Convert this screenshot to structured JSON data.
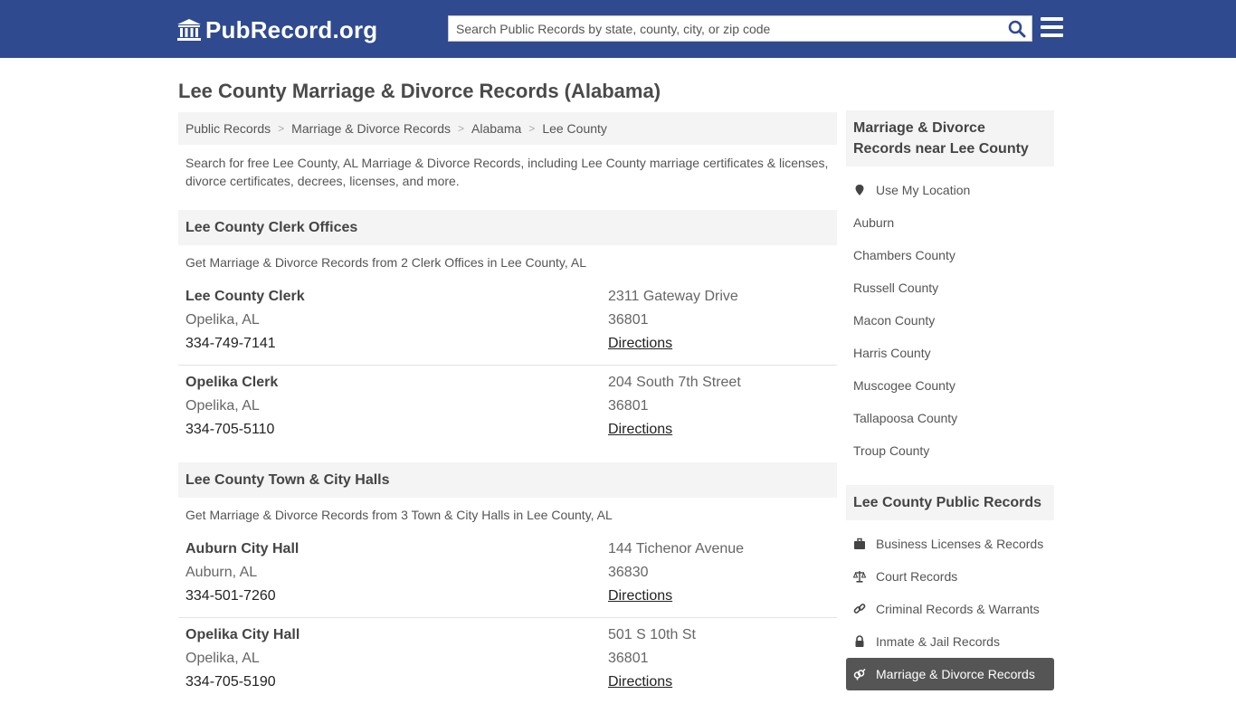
{
  "header": {
    "logo_text": "PubRecord.org",
    "search_placeholder": "Search Public Records by state, county, city, or zip code"
  },
  "page_title": "Lee County Marriage & Divorce Records (Alabama)",
  "breadcrumb": [
    "Public Records",
    "Marriage & Divorce Records",
    "Alabama",
    "Lee County"
  ],
  "intro": "Search for free Lee County, AL Marriage & Divorce Records, including Lee County marriage certificates & licenses, divorce certificates, decrees, licenses, and more.",
  "clerk_section": {
    "title": "Lee County Clerk Offices",
    "subtitle": "Get Marriage & Divorce Records from 2 Clerk Offices in Lee County, AL",
    "offices": [
      {
        "name": "Lee County Clerk",
        "city": "Opelika, AL",
        "phone": "334-749-7141",
        "address": "2311 Gateway Drive",
        "zip": "36801",
        "directions": "Directions"
      },
      {
        "name": "Opelika Clerk",
        "city": "Opelika, AL",
        "phone": "334-705-5110",
        "address": "204 South 7th Street",
        "zip": "36801",
        "directions": "Directions"
      }
    ]
  },
  "hall_section": {
    "title": "Lee County Town & City Halls",
    "subtitle": "Get Marriage & Divorce Records from 3 Town & City Halls in Lee County, AL",
    "offices": [
      {
        "name": "Auburn City Hall",
        "city": "Auburn, AL",
        "phone": "334-501-7260",
        "address": "144 Tichenor Avenue",
        "zip": "36830",
        "directions": "Directions"
      },
      {
        "name": "Opelika City Hall",
        "city": "Opelika, AL",
        "phone": "334-705-5190",
        "address": "501 S 10th St",
        "zip": "36801",
        "directions": "Directions"
      }
    ]
  },
  "sidebar": {
    "nearby_title": "Marriage & Divorce Records near Lee County",
    "nearby": [
      "Use My Location",
      "Auburn",
      "Chambers County",
      "Russell County",
      "Macon County",
      "Harris County",
      "Muscogee County",
      "Tallapoosa County",
      "Troup County"
    ],
    "public_title": "Lee County Public Records",
    "public": [
      {
        "label": "Business Licenses & Records",
        "icon": "briefcase-icon"
      },
      {
        "label": "Court Records",
        "icon": "scales-icon"
      },
      {
        "label": "Criminal Records & Warrants",
        "icon": "link-icon"
      },
      {
        "label": "Inmate & Jail Records",
        "icon": "lock-icon"
      },
      {
        "label": "Marriage & Divorce Records",
        "icon": "gender-icon",
        "active": true
      }
    ]
  },
  "colors": {
    "header_bg": "#2f4a8f",
    "active_bg": "#555555",
    "panel_bg": "#f4f4f4"
  }
}
